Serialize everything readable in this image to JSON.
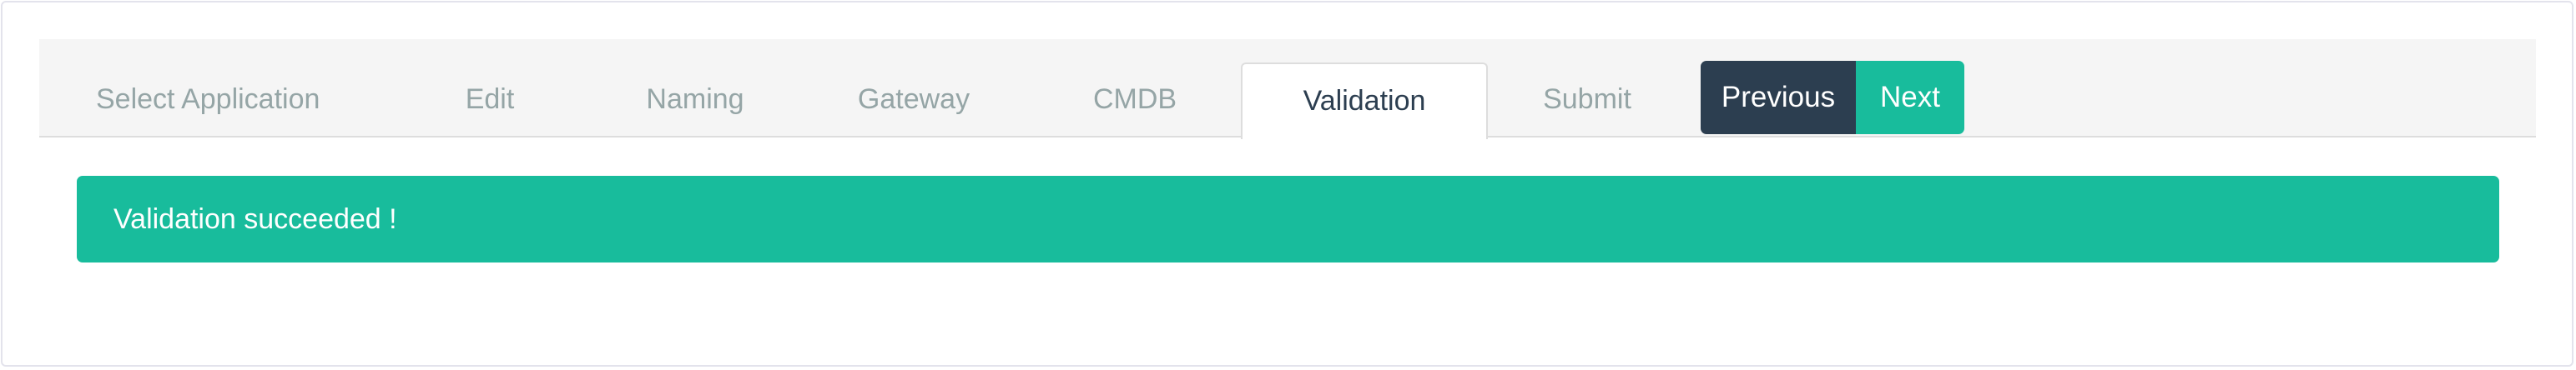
{
  "wizard": {
    "tabs": [
      {
        "label": "Select Application",
        "active": false
      },
      {
        "label": "Edit",
        "active": false
      },
      {
        "label": "Naming",
        "active": false
      },
      {
        "label": "Gateway",
        "active": false
      },
      {
        "label": "CMDB",
        "active": false
      },
      {
        "label": "Validation",
        "active": true
      },
      {
        "label": "Submit",
        "active": false
      }
    ],
    "previous_label": "Previous",
    "next_label": "Next"
  },
  "alert": {
    "message": "Validation succeeded !",
    "type": "success"
  },
  "colors": {
    "primary": "#2c3e50",
    "success": "#18bc9c",
    "muted_text": "#95a5a6",
    "tabbar_bg": "#f5f5f5"
  }
}
